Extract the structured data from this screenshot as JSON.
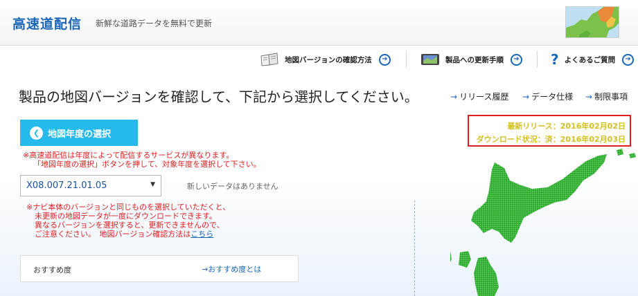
{
  "header": {
    "brand": "高速道配信",
    "tagline": "新鮮な道路データを無料で更新"
  },
  "nav": {
    "items": [
      {
        "label": "地図バージョンの確認方法"
      },
      {
        "label": "製品への更新手順"
      },
      {
        "label": "よくあるご質問"
      }
    ]
  },
  "main": {
    "title": "製品の地図バージョンを確認して、下記から選択してください。",
    "side_links": [
      {
        "label": "リリース履歴"
      },
      {
        "label": "データ仕様"
      },
      {
        "label": "制限事項"
      }
    ],
    "year_button": "地図年度の選択",
    "year_note_line1": "※高速道配信は年度によって配信するサービスが異なります。",
    "year_note_line2": "「地図年度の選択」ボタンを押して、対象年度を選択して下さい。",
    "version_select_value": "X08.007.21.01.05",
    "no_data_text": "新しいデータはありません",
    "version_note_line1": "※ナビ本体のバージョンと同じものを選択していただくと、",
    "version_note_line2": "未更新の地図データが一度にダウンロードできます。",
    "version_note_line3": "異なるバージョンを選択すると、更新できませんので、",
    "version_note_line4_prefix": "ご注意ください。　地図バージョン確認方法は",
    "version_note_link": "こちら",
    "recommend_label": "おすすめ度",
    "recommend_link": "おすすめ度とは",
    "release": {
      "latest": "最新リリース：2016年02月02日",
      "download_status": "ダウンロード状況：済：2016年02月03日"
    }
  },
  "colors": {
    "brand_blue": "#1a66b8",
    "button_cyan": "#25b9ec",
    "alert_red": "#e02020",
    "release_yellow": "#d4c020",
    "map_green": "#3cbf3c"
  }
}
